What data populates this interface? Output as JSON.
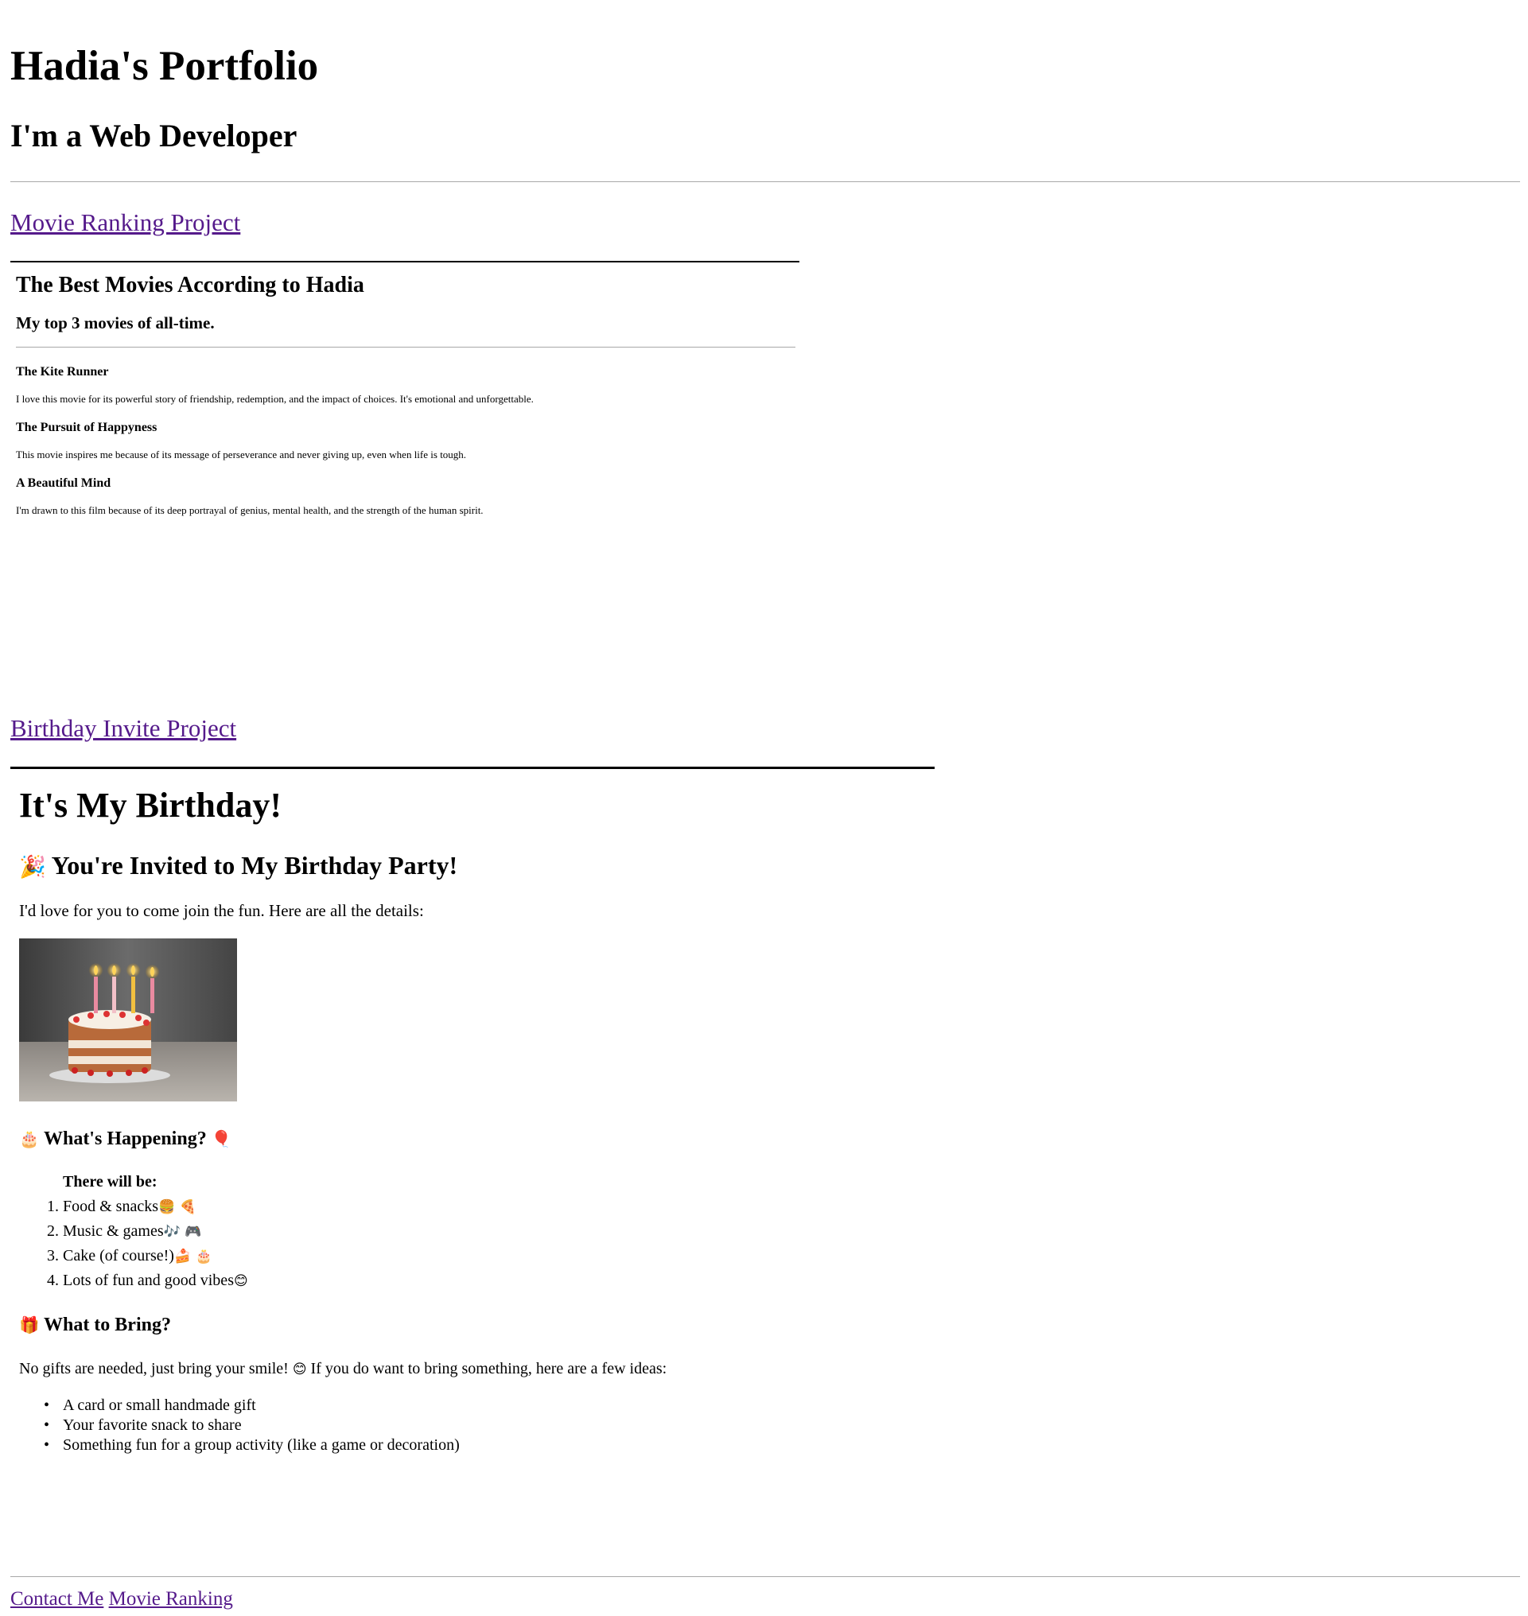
{
  "header": {
    "title": "Hadia's Portfolio",
    "subtitle": "I'm a Web Developer"
  },
  "movie_section": {
    "link_label": "Movie Ranking Project",
    "title": "The Best Movies According to Hadia",
    "subtitle": "My top 3 movies of all-time.",
    "movies": [
      {
        "name": "The Kite Runner",
        "description": "I love this movie for its powerful story of friendship, redemption, and the impact of choices. It's emotional and unforgettable."
      },
      {
        "name": "The Pursuit of Happyness",
        "description": "This movie inspires me because of its message of perseverance and never giving up, even when life is tough."
      },
      {
        "name": "A Beautiful Mind",
        "description": "I'm drawn to this film because of its deep portrayal of genius, mental health, and the strength of the human spirit."
      }
    ]
  },
  "birthday_section": {
    "link_label": "Birthday Invite Project",
    "title": "It's My Birthday!",
    "invite_emoji": "🎉",
    "invite_heading": "You're Invited to My Birthday Party!",
    "invite_text": "I'd love for you to come join the fun. Here are all the details:",
    "image_alt": "birthday cake with candles",
    "happening_emoji": "🎂",
    "happening_heading": "What's Happening?",
    "happening_emoji_after": "🎈",
    "list_intro": "There will be:",
    "activities": [
      {
        "label": "Food & snacks",
        "emoji": "🍔 🍕"
      },
      {
        "label": "Music & games",
        "emoji": "🎶 🎮"
      },
      {
        "label": "Cake (of course!)",
        "emoji": "🍰 🎂"
      },
      {
        "label": "Lots of fun and good vibes",
        "emoji": "😊"
      }
    ],
    "bring_emoji": "🎁",
    "bring_heading": "What to Bring?",
    "bring_text_before": "No gifts are needed, just bring your smile!",
    "bring_text_emoji": "😊",
    "bring_text_after": "If you do want to bring something, here are a few ideas:",
    "ideas": [
      "A card or small handmade gift",
      "Your favorite snack to share",
      "Something fun for a group activity (like a game or decoration)"
    ]
  },
  "footer": {
    "links": [
      "Contact Me",
      "Movie Ranking"
    ]
  },
  "colors": {
    "link": "#551a8b",
    "text": "#000000",
    "rule": "#a8a8a8"
  }
}
